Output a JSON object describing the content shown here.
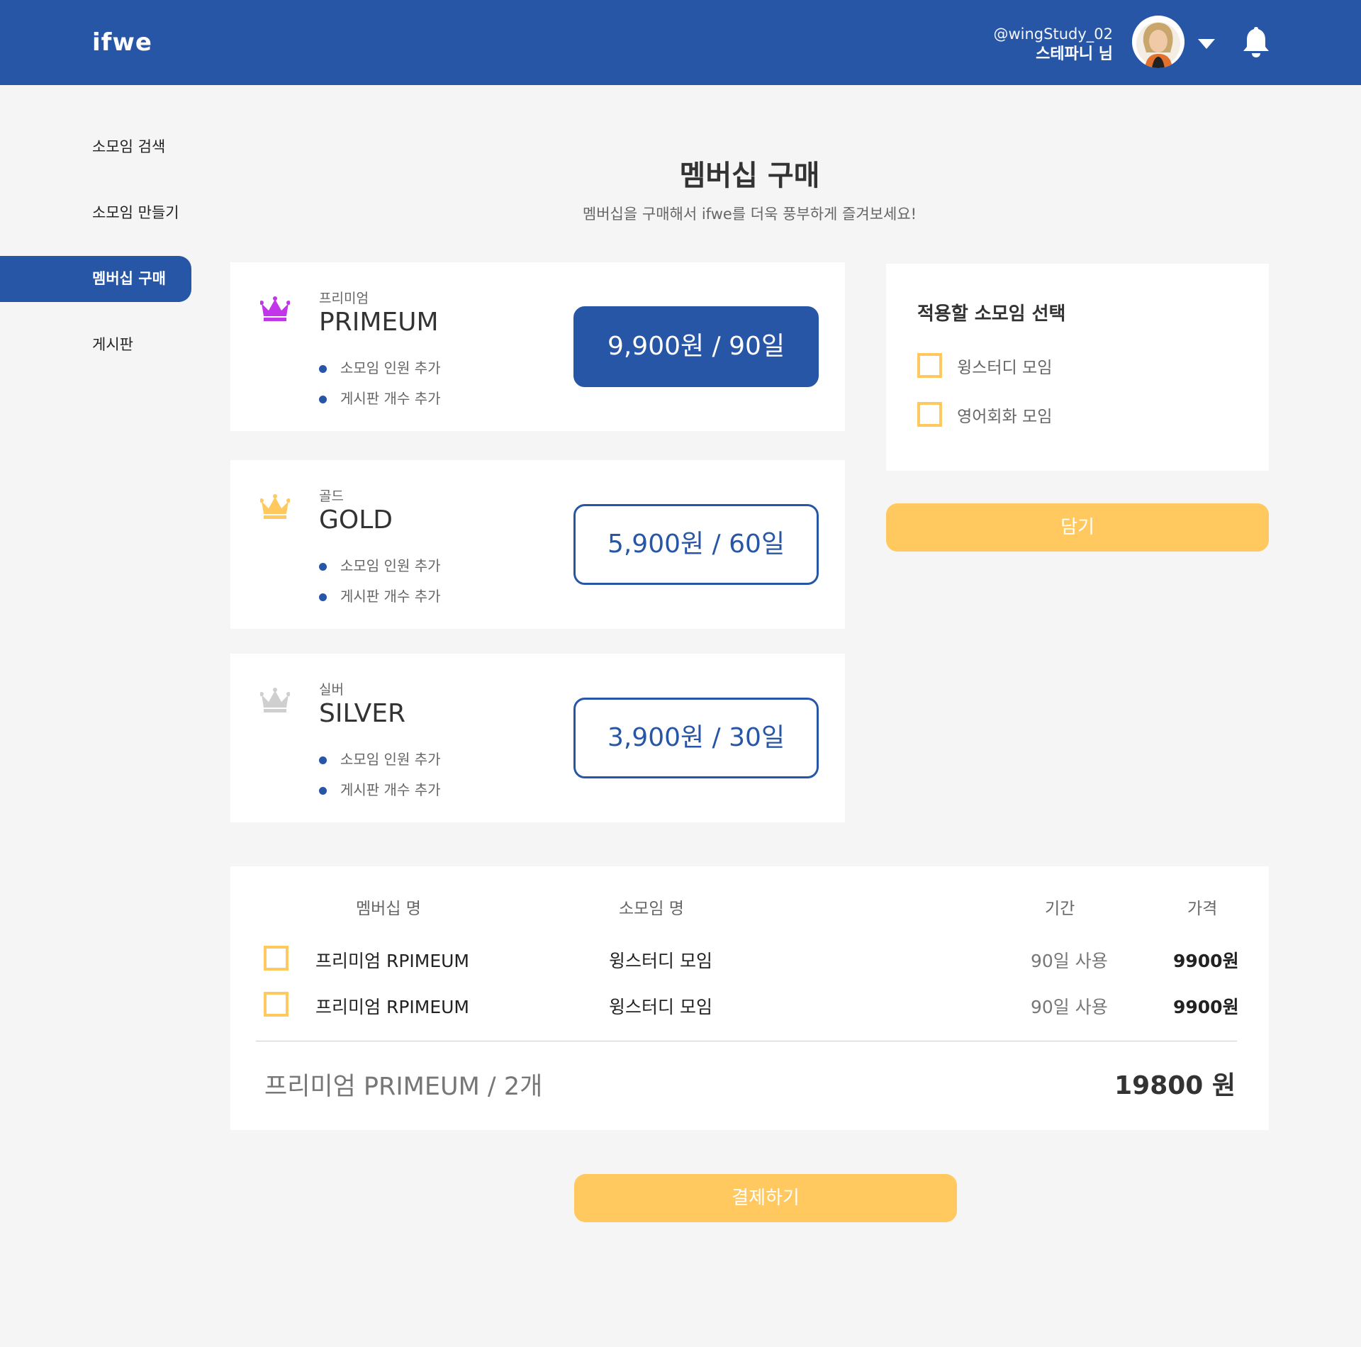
{
  "header": {
    "logo": "ifwe",
    "user_handle": "@wingStudy_02",
    "user_name": "스테파니 님",
    "icons": [
      "avatar",
      "chevron-down-icon",
      "bell-icon"
    ]
  },
  "sidebar": {
    "items": [
      {
        "label": "소모임 검색",
        "active": false
      },
      {
        "label": "소모임 만들기",
        "active": false
      },
      {
        "label": "멤버십 구매",
        "active": true
      },
      {
        "label": "게시판",
        "active": false
      }
    ]
  },
  "page": {
    "title": "멤버십 구매",
    "subtitle": "멤버십을 구매해서 ifwe를 더욱 풍부하게 즐겨보세요!"
  },
  "plans": [
    {
      "name_ko": "프리미엄",
      "name_en": "PRIMEUM",
      "crown_color": "#c036e8",
      "features": [
        "소모임 인원 추가",
        "게시판 개수 추가"
      ],
      "price_label": "9,900원 / 90일",
      "selected": true
    },
    {
      "name_ko": "골드",
      "name_en": "GOLD",
      "crown_color": "#ffc95f",
      "features": [
        "소모임 인원 추가",
        "게시판 개수 추가"
      ],
      "price_label": "5,900원 / 60일",
      "selected": false
    },
    {
      "name_ko": "실버",
      "name_en": "SILVER",
      "crown_color": "#cfcfcf",
      "features": [
        "소모임 인원 추가",
        "게시판 개수 추가"
      ],
      "price_label": "3,900원 / 30일",
      "selected": false
    }
  ],
  "group_select": {
    "title": "적용할 소모임 선택",
    "options": [
      "윙스터디 모임",
      "영어회화 모임"
    ],
    "add_button": "담기"
  },
  "cart": {
    "headers": {
      "membership": "멤버십 명",
      "group": "소모임 명",
      "period": "기간",
      "price": "가격"
    },
    "rows": [
      {
        "membership": "프리미엄 RPIMEUM",
        "group": "윙스터디 모임",
        "period": "90일 사용",
        "price": "9900원"
      },
      {
        "membership": "프리미엄 RPIMEUM",
        "group": "윙스터디 모임",
        "period": "90일 사용",
        "price": "9900원"
      }
    ],
    "summary": "프리미엄 PRIMEUM  / 2개",
    "total": "19800 원"
  },
  "pay_button": "결제하기",
  "colors": {
    "brand_blue": "#2856a7",
    "accent_yellow": "#ffc95f",
    "background": "#f5f5f5"
  }
}
